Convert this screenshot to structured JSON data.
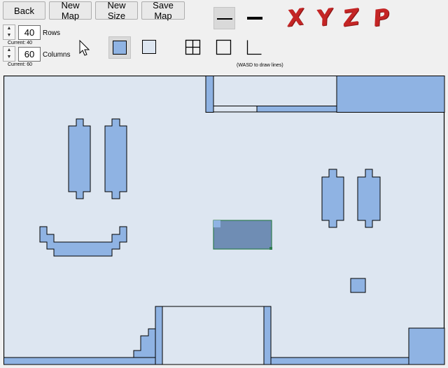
{
  "toolbar": {
    "back_label": "Back",
    "new_map_label": "New Map",
    "new_size_label": "New Size",
    "save_map_label": "Save Map"
  },
  "rows": {
    "value": "40",
    "label": "Rows",
    "current": "Current:  40"
  },
  "columns": {
    "value": "60",
    "label": "Columns",
    "current": "Current:  60"
  },
  "tools": {
    "fill_color": "#8fb3e3",
    "empty_color": "#dde6f1",
    "hint": "(WASD to draw lines)"
  },
  "axis_letters": [
    "X",
    "Y",
    "Z",
    "P"
  ],
  "map": {
    "floor_color": "#dde6f1",
    "wall_color": "#8fb3e3",
    "selection_color": "#6f8db4"
  }
}
